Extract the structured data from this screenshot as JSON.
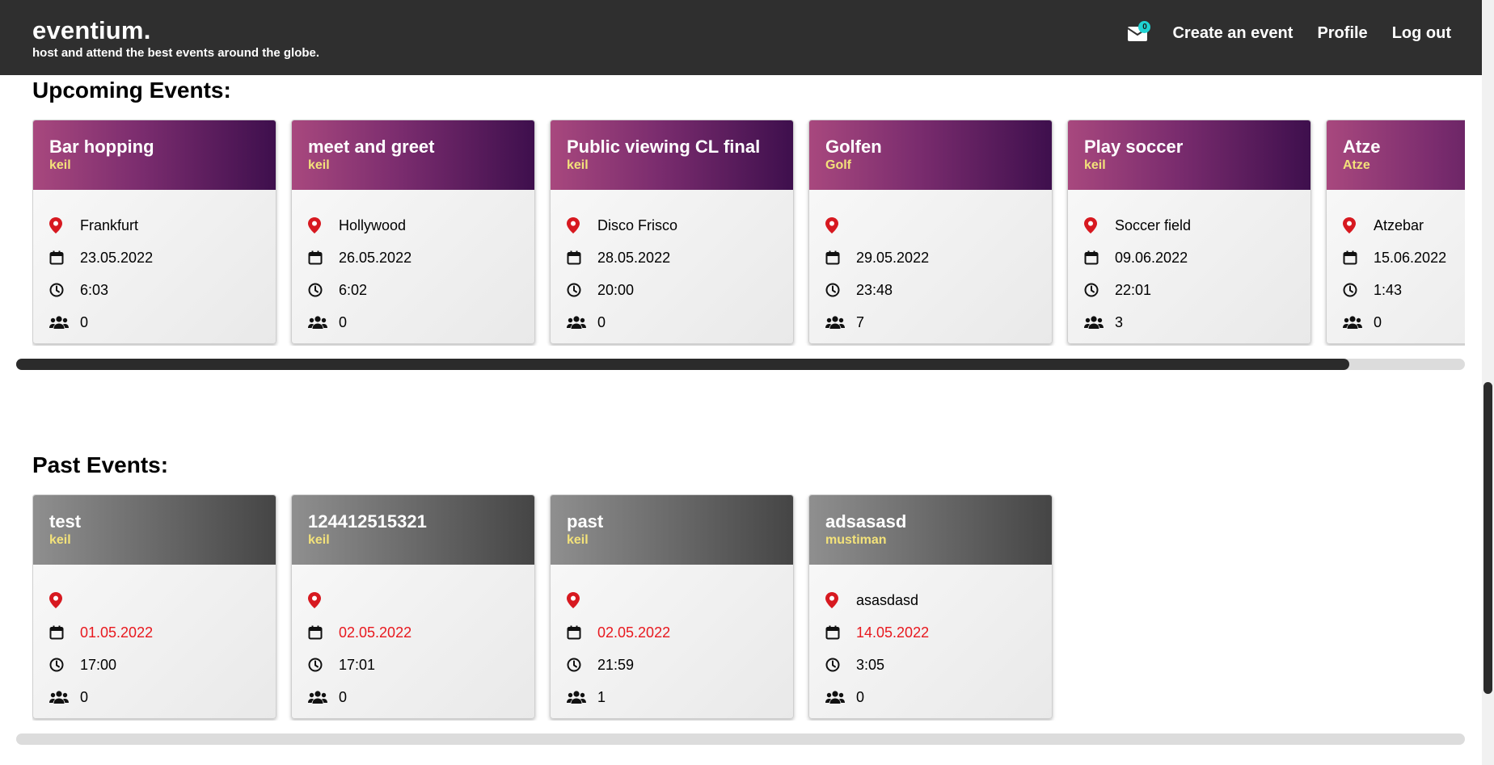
{
  "header": {
    "brand": "eventium.",
    "tagline": "host and attend the best events around the globe.",
    "mail_count": "0",
    "nav": [
      "Create an event",
      "Profile",
      "Log out"
    ]
  },
  "upcoming": {
    "title": "Upcoming Events:",
    "events": [
      {
        "title": "Bar hopping",
        "host": "keil",
        "location": "Frankfurt",
        "date": "23.05.2022",
        "time": "6:03",
        "attendees": "0"
      },
      {
        "title": "meet and greet",
        "host": "keil",
        "location": "Hollywood",
        "date": "26.05.2022",
        "time": "6:02",
        "attendees": "0"
      },
      {
        "title": "Public viewing CL final",
        "host": "keil",
        "location": "Disco Frisco",
        "date": "28.05.2022",
        "time": "20:00",
        "attendees": "0"
      },
      {
        "title": "Golfen",
        "host": "Golf",
        "location": "",
        "date": "29.05.2022",
        "time": "23:48",
        "attendees": "7"
      },
      {
        "title": "Play soccer",
        "host": "keil",
        "location": "Soccer field",
        "date": "09.06.2022",
        "time": "22:01",
        "attendees": "3"
      },
      {
        "title": "Atze",
        "host": "Atze",
        "location": "Atzebar",
        "date": "15.06.2022",
        "time": "1:43",
        "attendees": "0"
      }
    ],
    "scroll_fraction": 0.92
  },
  "past": {
    "title": "Past Events:",
    "events": [
      {
        "title": "test",
        "host": "keil",
        "location": "",
        "date": "01.05.2022",
        "time": "17:00",
        "attendees": "0"
      },
      {
        "title": "124412515321",
        "host": "keil",
        "location": "",
        "date": "02.05.2022",
        "time": "17:01",
        "attendees": "0"
      },
      {
        "title": "past",
        "host": "keil",
        "location": "",
        "date": "02.05.2022",
        "time": "21:59",
        "attendees": "1"
      },
      {
        "title": "adsasasd",
        "host": "mustiman",
        "location": "asasdasd",
        "date": "14.05.2022",
        "time": "3:05",
        "attendees": "0"
      }
    ]
  },
  "colors": {
    "header_bg": "#2f2f2f",
    "upcoming_header_start": "#a8487e",
    "upcoming_header_end": "#3e0f4d",
    "past_header_start": "#8f8f8f",
    "past_header_end": "#454545",
    "host_text": "#f3e27a",
    "past_date": "#e8181e",
    "pin_icon": "#d71920",
    "badge": "#1fd3d3"
  },
  "icons": [
    "mail-icon",
    "location-pin-icon",
    "calendar-icon",
    "clock-icon",
    "users-icon"
  ]
}
